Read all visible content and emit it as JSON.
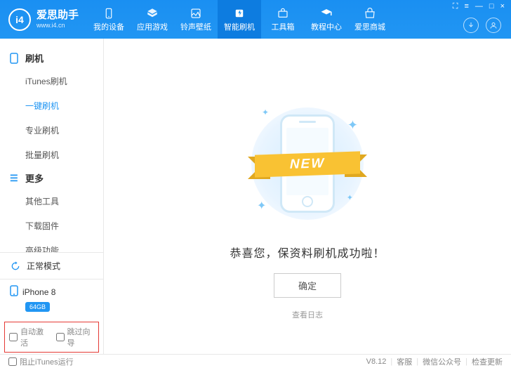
{
  "header": {
    "logo": {
      "badge": "i4",
      "title": "爱思助手",
      "url": "www.i4.cn"
    },
    "tabs": [
      {
        "label": "我的设备"
      },
      {
        "label": "应用游戏"
      },
      {
        "label": "铃声壁纸"
      },
      {
        "label": "智能刷机"
      },
      {
        "label": "工具箱"
      },
      {
        "label": "教程中心"
      },
      {
        "label": "爱思商城"
      }
    ],
    "active_tab_index": 3,
    "window_controls": {
      "cart": "⛶",
      "settings": "≡",
      "min": "—",
      "max": "□",
      "close": "×"
    }
  },
  "sidebar": {
    "sections": [
      {
        "title": "刷机",
        "items": [
          "iTunes刷机",
          "一键刷机",
          "专业刷机",
          "批量刷机"
        ],
        "active_index": 1
      },
      {
        "title": "更多",
        "items": [
          "其他工具",
          "下载固件",
          "高级功能"
        ],
        "active_index": -1
      }
    ],
    "mode_label": "正常模式",
    "device": {
      "name": "iPhone 8",
      "storage": "64GB"
    },
    "checkboxes": [
      {
        "label": "自动激活",
        "checked": false
      },
      {
        "label": "跳过向导",
        "checked": false
      }
    ]
  },
  "main": {
    "ribbon_text": "NEW",
    "success_message": "恭喜您，保资料刷机成功啦！",
    "ok_button": "确定",
    "log_link": "查看日志"
  },
  "footer": {
    "stop_itunes": "阻止iTunes运行",
    "version": "V8.12",
    "items": [
      "客服",
      "微信公众号",
      "检查更新"
    ]
  }
}
